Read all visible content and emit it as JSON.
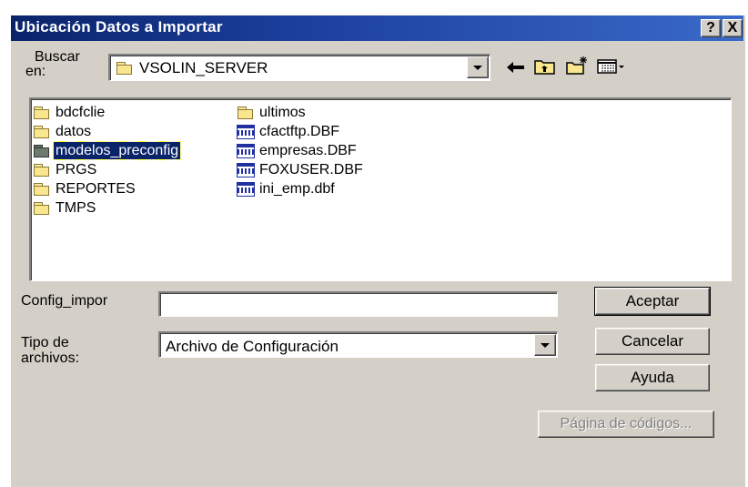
{
  "window": {
    "title": "Ubicación Datos a Importar",
    "help_label": "?",
    "close_label": "X"
  },
  "lookin": {
    "label_line1": "Buscar",
    "label_line2": "en:",
    "value": "VSOLIN_SERVER"
  },
  "toolbar": {
    "icons": [
      "back-arrow-icon",
      "up-folder-icon",
      "new-folder-icon",
      "view-menu-icon"
    ]
  },
  "files": {
    "column1": [
      {
        "name": "bdcfclie",
        "type": "folder"
      },
      {
        "name": "datos",
        "type": "folder"
      },
      {
        "name": "modelos_preconfig",
        "type": "folder",
        "selected": true
      },
      {
        "name": "PRGS",
        "type": "folder"
      },
      {
        "name": "REPORTES",
        "type": "folder"
      },
      {
        "name": "TMPS",
        "type": "folder"
      }
    ],
    "column2": [
      {
        "name": "ultimos",
        "type": "folder"
      },
      {
        "name": "cfactftp.DBF",
        "type": "dbf"
      },
      {
        "name": "empresas.DBF",
        "type": "dbf"
      },
      {
        "name": "FOXUSER.DBF",
        "type": "dbf"
      },
      {
        "name": "ini_emp.dbf",
        "type": "dbf"
      }
    ]
  },
  "form": {
    "filename_label": "Config_impor",
    "filename_value": "",
    "filetype_label_line1": "Tipo de",
    "filetype_label_line2": "archivos:",
    "filetype_value": "Archivo de Configuración"
  },
  "buttons": {
    "accept": "Aceptar",
    "cancel": "Cancelar",
    "help": "Ayuda",
    "codepage": "Página de códigos..."
  },
  "colors": {
    "title_bar": "#0a246a",
    "dialog_bg": "#d4d0c8",
    "selection": "#0a246a"
  }
}
